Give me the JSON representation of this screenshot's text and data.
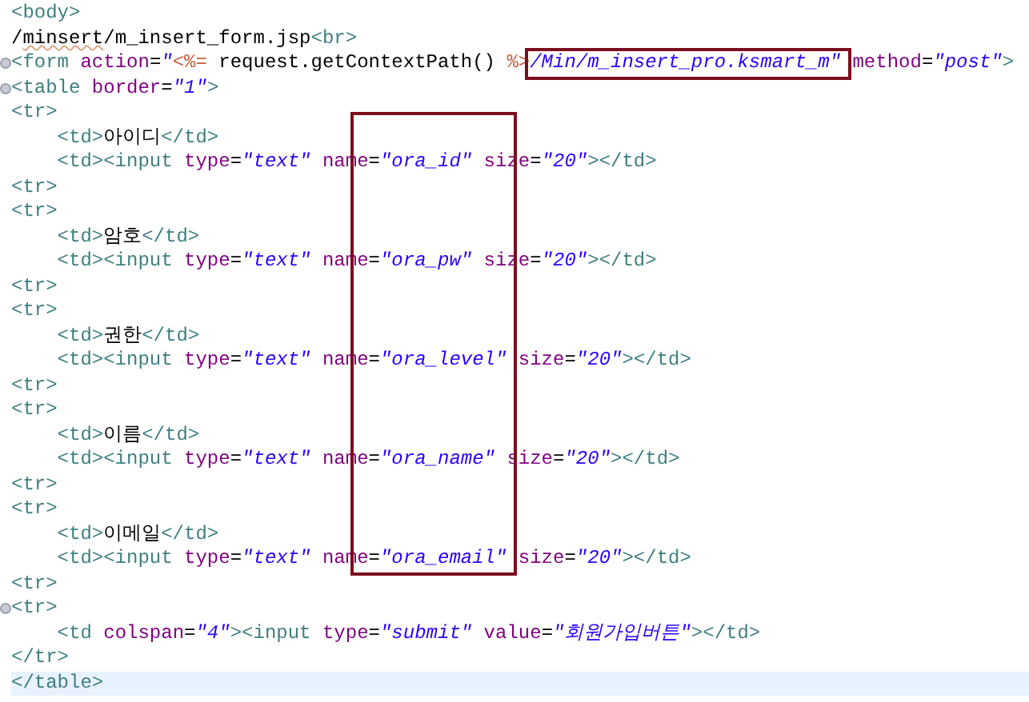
{
  "editor": {
    "lines": [
      {
        "tokens": [
          {
            "kind": "tag",
            "text": "<body>"
          }
        ]
      },
      {
        "tokens": [
          {
            "kind": "text",
            "text": "/"
          },
          {
            "kind": "text",
            "text": "minsert",
            "spell_error": true
          },
          {
            "kind": "text",
            "text": "/m_insert_form.jsp"
          },
          {
            "kind": "tag",
            "text": "<br>"
          }
        ]
      },
      {
        "fold": true,
        "tokens": [
          {
            "kind": "tag",
            "text": "<form"
          },
          {
            "kind": "attr",
            "text": " action"
          },
          {
            "kind": "text",
            "text": "="
          },
          {
            "kind": "value",
            "text": "\""
          },
          {
            "kind": "jsp",
            "text": "<%="
          },
          {
            "kind": "text",
            "text": " request.getContextPath() "
          },
          {
            "kind": "jsp",
            "text": "%>"
          },
          {
            "kind": "value",
            "text": "/Min/m_insert_pro.ksmart_m\"",
            "framed": true,
            "frame_start": true
          },
          {
            "kind": "attr",
            "text": " method"
          },
          {
            "kind": "text",
            "text": "="
          },
          {
            "kind": "value",
            "text": "\"post\""
          },
          {
            "kind": "tag",
            "text": ">"
          }
        ]
      },
      {
        "fold": true,
        "tokens": [
          {
            "kind": "tag",
            "text": "<table"
          },
          {
            "kind": "attr",
            "text": " border"
          },
          {
            "kind": "text",
            "text": "="
          },
          {
            "kind": "value",
            "text": "\"1\""
          },
          {
            "kind": "tag",
            "text": ">"
          }
        ]
      },
      {
        "tokens": [
          {
            "kind": "tag",
            "text": "<tr>"
          }
        ]
      },
      {
        "tokens": [
          {
            "kind": "tag",
            "text": "    <td>"
          },
          {
            "kind": "text",
            "text": "아이디"
          },
          {
            "kind": "tag",
            "text": "</td>"
          }
        ]
      },
      {
        "tokens": [
          {
            "kind": "tag",
            "text": "    <td><input"
          },
          {
            "kind": "attr",
            "text": " type"
          },
          {
            "kind": "text",
            "text": "="
          },
          {
            "kind": "value",
            "text": "\"text\""
          },
          {
            "kind": "attr",
            "text": " name"
          },
          {
            "kind": "text",
            "text": "="
          },
          {
            "kind": "value",
            "text": "\"ora_id\"",
            "framed": true,
            "frame_start": true
          },
          {
            "kind": "attr",
            "text": " size"
          },
          {
            "kind": "text",
            "text": "="
          },
          {
            "kind": "value",
            "text": "\"20\""
          },
          {
            "kind": "tag",
            "text": "></td>"
          }
        ]
      },
      {
        "tokens": [
          {
            "kind": "tag",
            "text": "<tr>"
          }
        ]
      },
      {
        "tokens": [
          {
            "kind": "tag",
            "text": "<tr>"
          }
        ]
      },
      {
        "tokens": [
          {
            "kind": "tag",
            "text": "    <td>"
          },
          {
            "kind": "text",
            "text": "암호"
          },
          {
            "kind": "tag",
            "text": "</td>"
          }
        ]
      },
      {
        "tokens": [
          {
            "kind": "tag",
            "text": "    <td><input"
          },
          {
            "kind": "attr",
            "text": " type"
          },
          {
            "kind": "text",
            "text": "="
          },
          {
            "kind": "value",
            "text": "\"text\""
          },
          {
            "kind": "attr",
            "text": " name"
          },
          {
            "kind": "text",
            "text": "="
          },
          {
            "kind": "value",
            "text": "\"ora_pw\"",
            "framed": true
          },
          {
            "kind": "attr",
            "text": " size"
          },
          {
            "kind": "text",
            "text": "="
          },
          {
            "kind": "value",
            "text": "\"20\""
          },
          {
            "kind": "tag",
            "text": "></td>"
          }
        ]
      },
      {
        "tokens": [
          {
            "kind": "tag",
            "text": "<tr>"
          }
        ]
      },
      {
        "tokens": [
          {
            "kind": "tag",
            "text": "<tr>"
          }
        ]
      },
      {
        "tokens": [
          {
            "kind": "tag",
            "text": "    <td>"
          },
          {
            "kind": "text",
            "text": "권한"
          },
          {
            "kind": "tag",
            "text": "</td>"
          }
        ]
      },
      {
        "tokens": [
          {
            "kind": "tag",
            "text": "    <td><input"
          },
          {
            "kind": "attr",
            "text": " type"
          },
          {
            "kind": "text",
            "text": "="
          },
          {
            "kind": "value",
            "text": "\"text\""
          },
          {
            "kind": "attr",
            "text": " name"
          },
          {
            "kind": "text",
            "text": "="
          },
          {
            "kind": "value",
            "text": "\"ora_level\"",
            "framed": true
          },
          {
            "kind": "attr",
            "text": " size"
          },
          {
            "kind": "text",
            "text": "="
          },
          {
            "kind": "value",
            "text": "\"20\""
          },
          {
            "kind": "tag",
            "text": "></td>"
          }
        ]
      },
      {
        "tokens": [
          {
            "kind": "tag",
            "text": "<tr>"
          }
        ]
      },
      {
        "tokens": [
          {
            "kind": "tag",
            "text": "<tr>"
          }
        ]
      },
      {
        "tokens": [
          {
            "kind": "tag",
            "text": "    <td>"
          },
          {
            "kind": "text",
            "text": "이름"
          },
          {
            "kind": "tag",
            "text": "</td>"
          }
        ]
      },
      {
        "tokens": [
          {
            "kind": "tag",
            "text": "    <td><input"
          },
          {
            "kind": "attr",
            "text": " type"
          },
          {
            "kind": "text",
            "text": "="
          },
          {
            "kind": "value",
            "text": "\"text\""
          },
          {
            "kind": "attr",
            "text": " name"
          },
          {
            "kind": "text",
            "text": "="
          },
          {
            "kind": "value",
            "text": "\"ora_name\"",
            "framed": true
          },
          {
            "kind": "attr",
            "text": " size"
          },
          {
            "kind": "text",
            "text": "="
          },
          {
            "kind": "value",
            "text": "\"20\""
          },
          {
            "kind": "tag",
            "text": "></td>"
          }
        ]
      },
      {
        "tokens": [
          {
            "kind": "tag",
            "text": "<tr>"
          }
        ]
      },
      {
        "tokens": [
          {
            "kind": "tag",
            "text": "<tr>"
          }
        ]
      },
      {
        "tokens": [
          {
            "kind": "tag",
            "text": "    <td>"
          },
          {
            "kind": "text",
            "text": "이메일"
          },
          {
            "kind": "tag",
            "text": "</td>"
          }
        ]
      },
      {
        "tokens": [
          {
            "kind": "tag",
            "text": "    <td><input"
          },
          {
            "kind": "attr",
            "text": " type"
          },
          {
            "kind": "text",
            "text": "="
          },
          {
            "kind": "value",
            "text": "\"text\""
          },
          {
            "kind": "attr",
            "text": " name"
          },
          {
            "kind": "text",
            "text": "="
          },
          {
            "kind": "value",
            "text": "\"ora_email\"",
            "framed": true
          },
          {
            "kind": "attr",
            "text": " size"
          },
          {
            "kind": "text",
            "text": "="
          },
          {
            "kind": "value",
            "text": "\"20\""
          },
          {
            "kind": "tag",
            "text": "></td>"
          }
        ]
      },
      {
        "tokens": [
          {
            "kind": "tag",
            "text": "<tr>"
          }
        ]
      },
      {
        "fold": true,
        "tokens": [
          {
            "kind": "tag",
            "text": "<tr>"
          }
        ]
      },
      {
        "tokens": [
          {
            "kind": "tag",
            "text": "    <td"
          },
          {
            "kind": "attr",
            "text": " colspan"
          },
          {
            "kind": "text",
            "text": "="
          },
          {
            "kind": "value",
            "text": "\"4\""
          },
          {
            "kind": "tag",
            "text": "><input"
          },
          {
            "kind": "attr",
            "text": " type"
          },
          {
            "kind": "text",
            "text": "="
          },
          {
            "kind": "value",
            "text": "\"submit\""
          },
          {
            "kind": "attr",
            "text": " value"
          },
          {
            "kind": "text",
            "text": "="
          },
          {
            "kind": "value",
            "text": "\"회원가입버튼\""
          },
          {
            "kind": "tag",
            "text": "></td>"
          }
        ]
      },
      {
        "tokens": [
          {
            "kind": "tag",
            "text": "</tr>"
          }
        ]
      },
      {
        "current": true,
        "tokens": [
          {
            "kind": "tag",
            "text": "</table>"
          }
        ]
      }
    ]
  }
}
